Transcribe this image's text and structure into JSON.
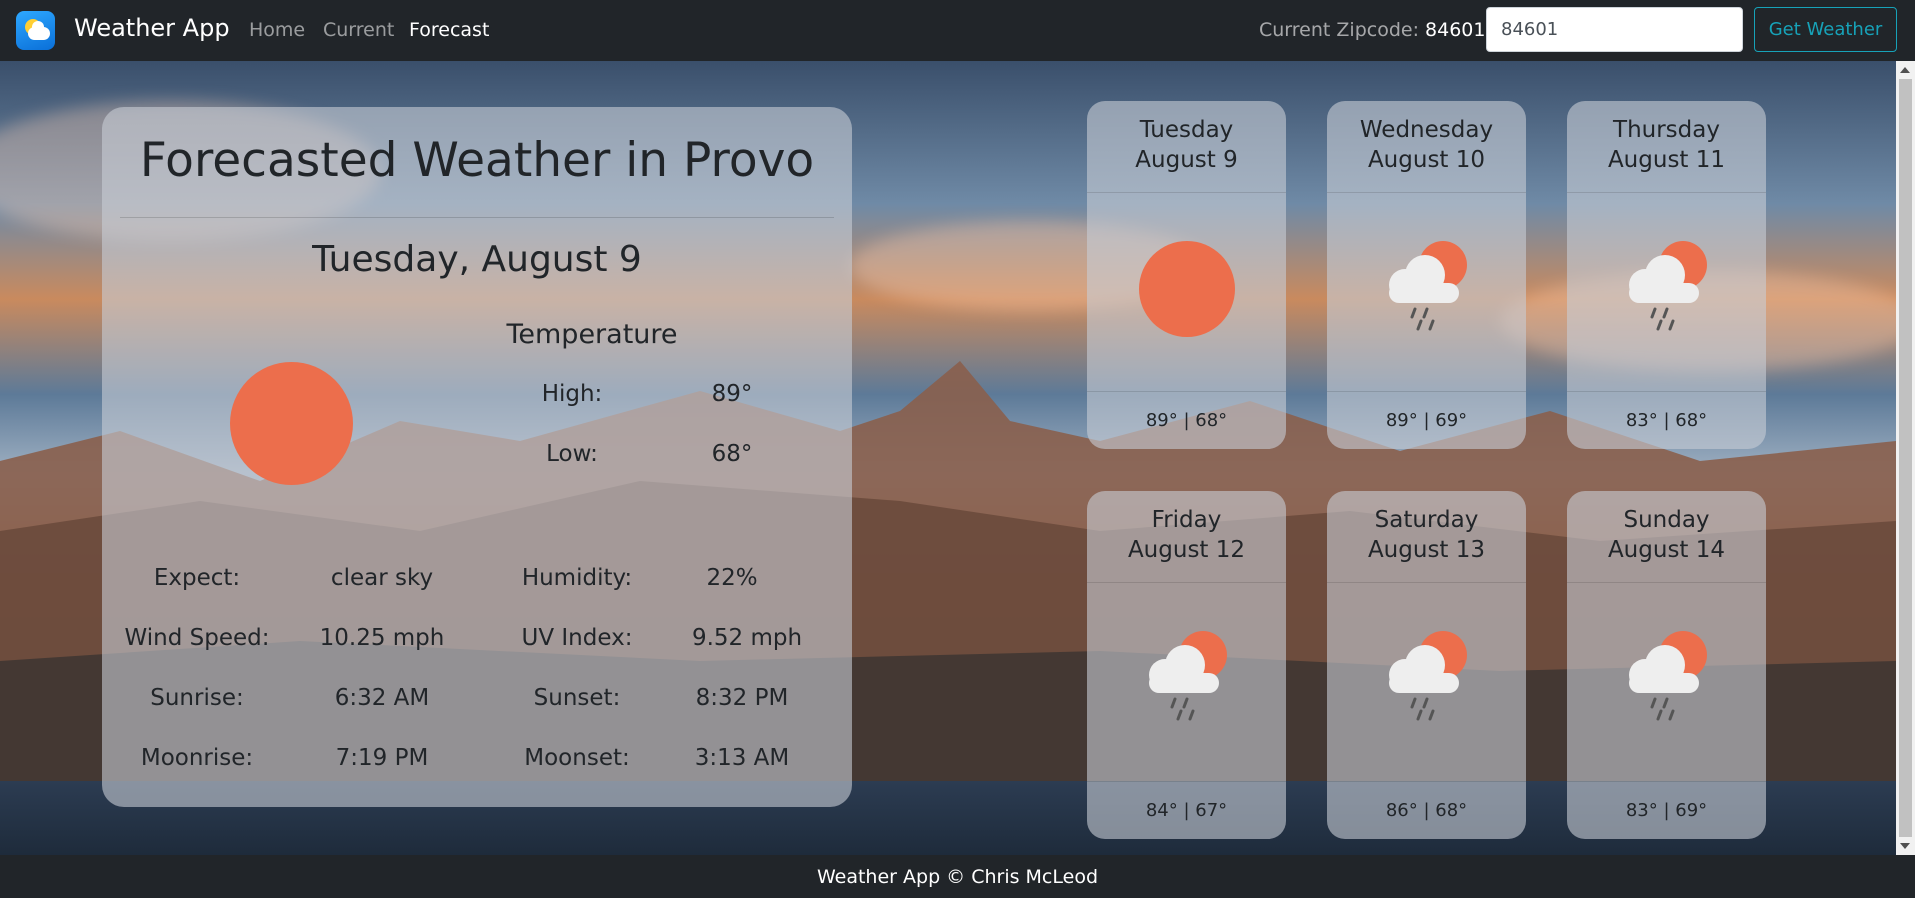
{
  "navbar": {
    "brand": "Weather App",
    "links": [
      "Home",
      "Current",
      "Forecast"
    ],
    "active_link": "Forecast",
    "zip_label": "Current Zipcode:",
    "zip_value": "84601",
    "zip_input_value": "84601",
    "button_label": "Get Weather"
  },
  "main": {
    "title": "Forecasted Weather in Provo",
    "date": "Tuesday, August 9",
    "icon": "sun-icon",
    "temperature_heading": "Temperature",
    "high_label": "High:",
    "high_value": "89°",
    "low_label": "Low:",
    "low_value": "68°",
    "details": [
      {
        "label": "Expect:",
        "value": "clear sky"
      },
      {
        "label": "Humidity:",
        "value": "22%"
      },
      {
        "label": "Wind Speed:",
        "value": "10.25 mph"
      },
      {
        "label": "UV Index:",
        "value": "9.52 mph"
      },
      {
        "label": "Sunrise:",
        "value": "6:32 AM"
      },
      {
        "label": "Sunset:",
        "value": "8:32 PM"
      },
      {
        "label": "Moonrise:",
        "value": "7:19 PM"
      },
      {
        "label": "Moonset:",
        "value": "3:13 AM"
      }
    ]
  },
  "forecast": [
    {
      "day": "Tuesday",
      "date": "August 9",
      "icon": "sun-icon",
      "temps": "89° | 68°"
    },
    {
      "day": "Wednesday",
      "date": "August 10",
      "icon": "rain-cloud-sun-icon",
      "temps": "89° | 69°"
    },
    {
      "day": "Thursday",
      "date": "August 11",
      "icon": "rain-cloud-sun-icon",
      "temps": "83° | 68°"
    },
    {
      "day": "Friday",
      "date": "August 12",
      "icon": "rain-cloud-sun-icon",
      "temps": "84° | 67°"
    },
    {
      "day": "Saturday",
      "date": "August 13",
      "icon": "rain-cloud-sun-icon",
      "temps": "86° | 68°"
    },
    {
      "day": "Sunday",
      "date": "August 14",
      "icon": "rain-cloud-sun-icon",
      "temps": "83° | 69°"
    }
  ],
  "footer": {
    "text": "Weather App © Chris McLeod"
  },
  "colors": {
    "navbar": "#212529",
    "accent": "#17a2b8",
    "sun": "#ec6e4c"
  }
}
